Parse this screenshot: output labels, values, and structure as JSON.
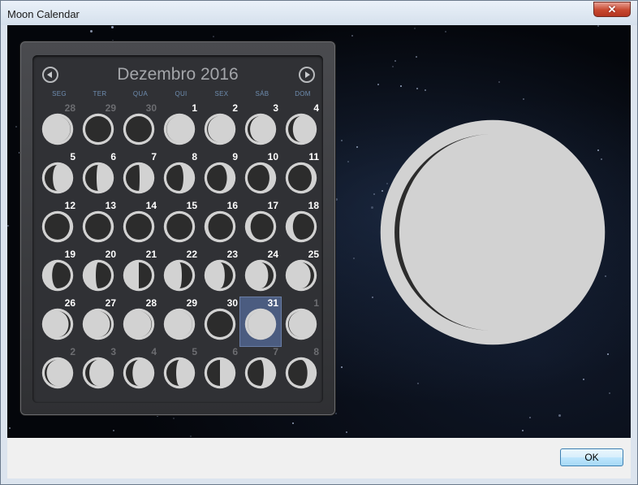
{
  "window": {
    "title": "Moon Calendar",
    "close_glyph": "✕"
  },
  "calendar": {
    "month_title": "Dezembro 2016",
    "weekdays": [
      "SEG",
      "TER",
      "QUA",
      "QUI",
      "SEX",
      "SÁB",
      "DOM"
    ],
    "days": [
      {
        "n": "28",
        "dim": true,
        "phase": 0.97
      },
      {
        "n": "29",
        "dim": true,
        "phase": 0.99
      },
      {
        "n": "30",
        "dim": true,
        "phase": 0.0
      },
      {
        "n": "1",
        "dim": false,
        "phase": 0.03
      },
      {
        "n": "2",
        "dim": false,
        "phase": 0.06
      },
      {
        "n": "3",
        "dim": false,
        "phase": 0.1
      },
      {
        "n": "4",
        "dim": false,
        "phase": 0.14
      },
      {
        "n": "5",
        "dim": false,
        "phase": 0.19
      },
      {
        "n": "6",
        "dim": false,
        "phase": 0.23
      },
      {
        "n": "7",
        "dim": false,
        "phase": 0.26
      },
      {
        "n": "8",
        "dim": false,
        "phase": 0.3
      },
      {
        "n": "9",
        "dim": false,
        "phase": 0.34
      },
      {
        "n": "10",
        "dim": false,
        "phase": 0.37
      },
      {
        "n": "11",
        "dim": false,
        "phase": 0.4
      },
      {
        "n": "12",
        "dim": false,
        "phase": 0.44
      },
      {
        "n": "13",
        "dim": false,
        "phase": 0.47
      },
      {
        "n": "14",
        "dim": false,
        "phase": 0.5
      },
      {
        "n": "15",
        "dim": false,
        "phase": 0.53
      },
      {
        "n": "16",
        "dim": false,
        "phase": 0.57
      },
      {
        "n": "17",
        "dim": false,
        "phase": 0.61
      },
      {
        "n": "18",
        "dim": false,
        "phase": 0.64
      },
      {
        "n": "19",
        "dim": false,
        "phase": 0.68
      },
      {
        "n": "20",
        "dim": false,
        "phase": 0.72
      },
      {
        "n": "21",
        "dim": false,
        "phase": 0.75
      },
      {
        "n": "22",
        "dim": false,
        "phase": 0.78
      },
      {
        "n": "23",
        "dim": false,
        "phase": 0.81
      },
      {
        "n": "24",
        "dim": false,
        "phase": 0.85
      },
      {
        "n": "25",
        "dim": false,
        "phase": 0.88
      },
      {
        "n": "26",
        "dim": false,
        "phase": 0.91
      },
      {
        "n": "27",
        "dim": false,
        "phase": 0.93
      },
      {
        "n": "28",
        "dim": false,
        "phase": 0.96
      },
      {
        "n": "29",
        "dim": false,
        "phase": 0.98
      },
      {
        "n": "30",
        "dim": false,
        "phase": 0.995
      },
      {
        "n": "31",
        "dim": false,
        "phase": 0.02,
        "today": true
      },
      {
        "n": "1",
        "dim": true,
        "phase": 0.05
      },
      {
        "n": "2",
        "dim": true,
        "phase": 0.09
      },
      {
        "n": "3",
        "dim": true,
        "phase": 0.13
      },
      {
        "n": "4",
        "dim": true,
        "phase": 0.17
      },
      {
        "n": "5",
        "dim": true,
        "phase": 0.21
      },
      {
        "n": "6",
        "dim": true,
        "phase": 0.25
      },
      {
        "n": "7",
        "dim": true,
        "phase": 0.29
      },
      {
        "n": "8",
        "dim": true,
        "phase": 0.33
      }
    ]
  },
  "selected_moon": {
    "phase": 0.05
  },
  "colors": {
    "moon_light": "#d2d2d2",
    "moon_dark": "#2c2c2c",
    "today_highlight": "#4b5c80"
  },
  "icons": {
    "prev": "chevron-left-icon",
    "next": "chevron-right-icon"
  },
  "footer": {
    "ok_label": "OK"
  }
}
